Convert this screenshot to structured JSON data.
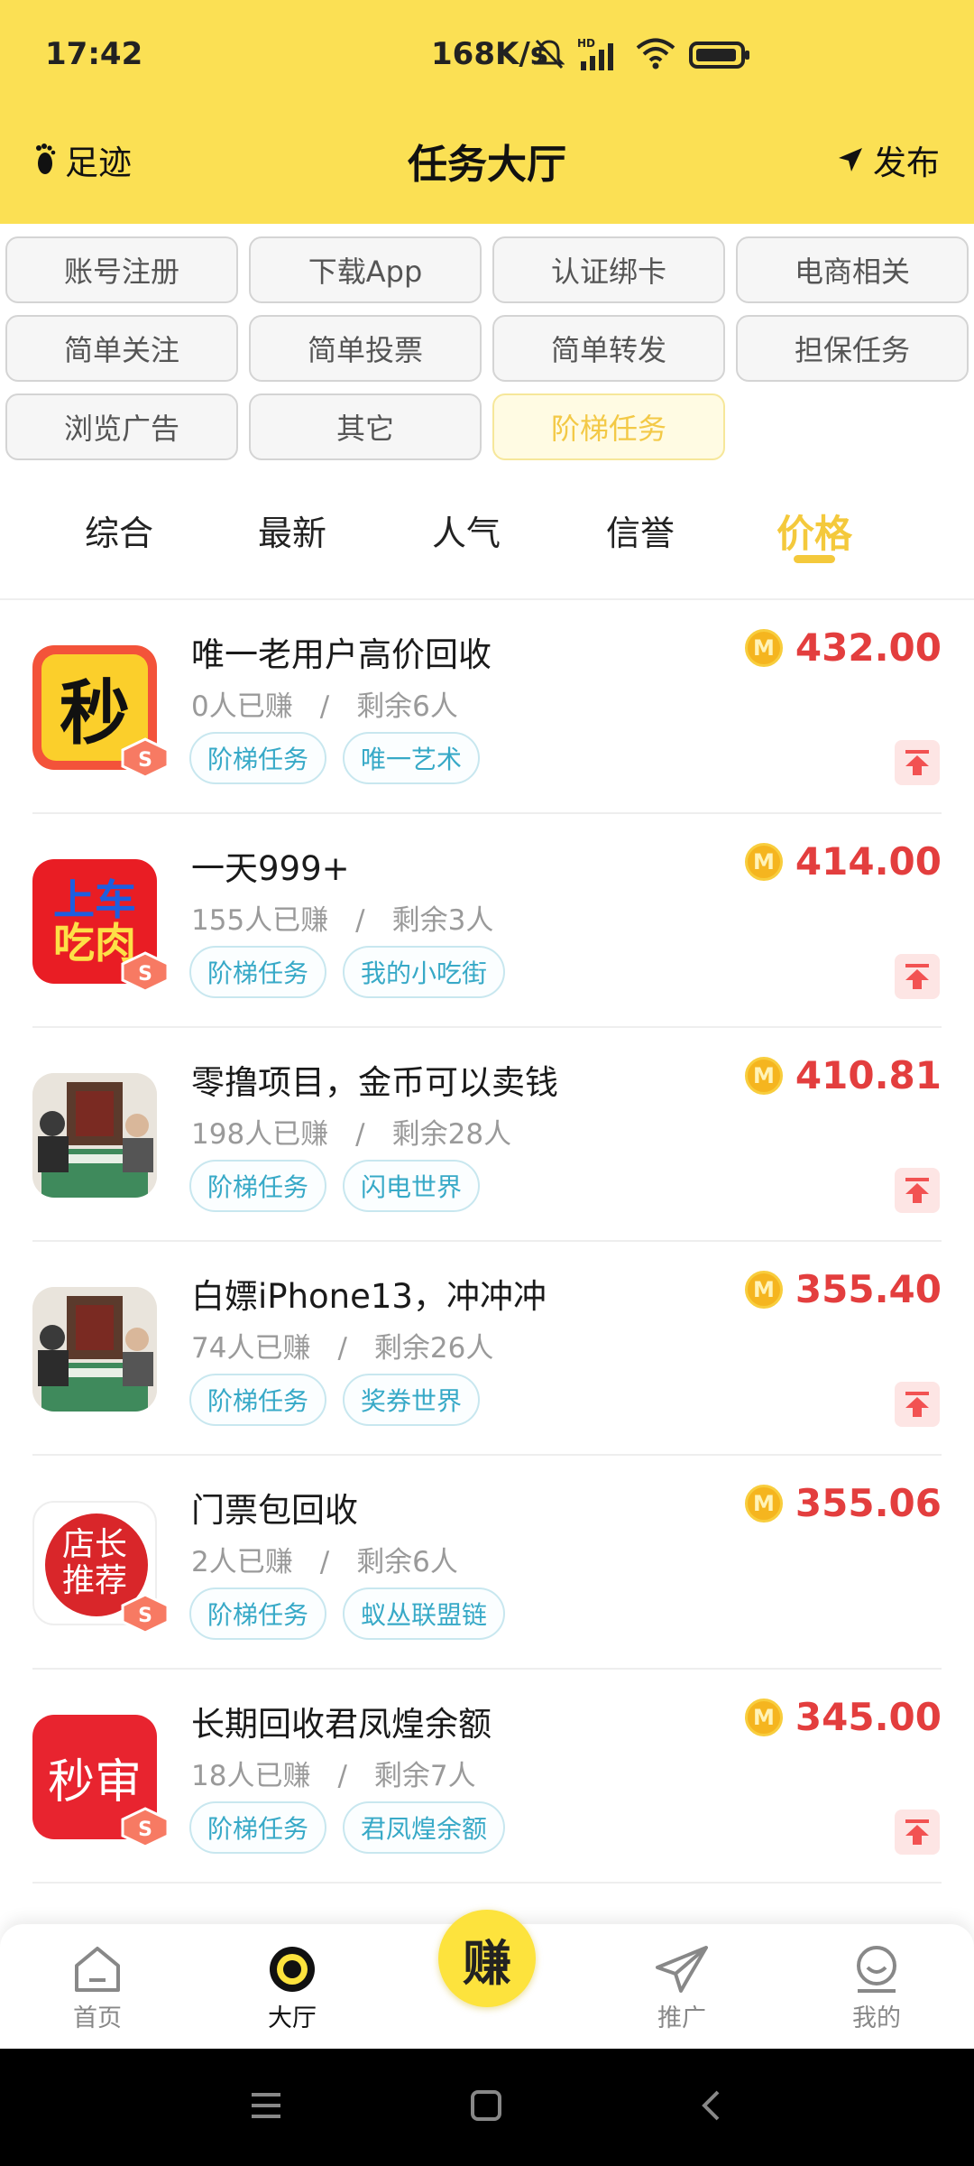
{
  "status": {
    "time": "17:42",
    "speed": "168K/s"
  },
  "nav": {
    "left_label": "足迹",
    "title": "任务大厅",
    "right_label": "发布"
  },
  "categories": [
    {
      "label": "账号注册",
      "active": false
    },
    {
      "label": "下载App",
      "active": false
    },
    {
      "label": "认证绑卡",
      "active": false
    },
    {
      "label": "电商相关",
      "active": false
    },
    {
      "label": "简单关注",
      "active": false
    },
    {
      "label": "简单投票",
      "active": false
    },
    {
      "label": "简单转发",
      "active": false
    },
    {
      "label": "担保任务",
      "active": false
    },
    {
      "label": "浏览广告",
      "active": false
    },
    {
      "label": "其它",
      "active": false
    },
    {
      "label": "阶梯任务",
      "active": true
    }
  ],
  "sort_tabs": [
    {
      "label": "综合",
      "active": false
    },
    {
      "label": "最新",
      "active": false
    },
    {
      "label": "人气",
      "active": false
    },
    {
      "label": "信誉",
      "active": false
    },
    {
      "label": "价格",
      "active": true
    }
  ],
  "tasks": [
    {
      "title": "唯一老用户高价回收",
      "earned": "0人已赚",
      "remaining": "剩余6人",
      "tags": [
        "阶梯任务",
        "唯一艺术"
      ],
      "price": "432.00",
      "icon": "miao-icon",
      "icon_text": "秒",
      "has_top": true
    },
    {
      "title": "一天999+",
      "earned": "155人已赚",
      "remaining": "剩余3人",
      "tags": [
        "阶梯任务",
        "我的小吃街"
      ],
      "price": "414.00",
      "icon": "shangche-chirou-icon",
      "icon_text_1": "上车",
      "icon_text_2": "吃肉",
      "has_top": true
    },
    {
      "title": "零撸项目，金币可以卖钱",
      "earned": "198人已赚",
      "remaining": "剩余28人",
      "tags": [
        "阶梯任务",
        "闪电世界"
      ],
      "price": "410.81",
      "icon": "photo-avatar-icon",
      "has_top": true
    },
    {
      "title": "白嫖iPhone13，冲冲冲",
      "earned": "74人已赚",
      "remaining": "剩余26人",
      "tags": [
        "阶梯任务",
        "奖券世界"
      ],
      "price": "355.40",
      "icon": "photo-avatar-icon",
      "has_top": true
    },
    {
      "title": "门票包回收",
      "earned": "2人已赚",
      "remaining": "剩余6人",
      "tags": [
        "阶梯任务",
        "蚁丛联盟链"
      ],
      "price": "355.06",
      "icon": "dianzhang-tuijian-icon",
      "icon_text_1": "店长",
      "icon_text_2": "推荐",
      "has_top": false
    },
    {
      "title": "长期回收君凤煌余额",
      "earned": "18人已赚",
      "remaining": "剩余7人",
      "tags": [
        "阶梯任务",
        "君凤煌余额"
      ],
      "price": "345.00",
      "icon": "miaoshen-icon",
      "icon_text": "秒审",
      "has_top": true
    }
  ],
  "coin_symbol": "M",
  "bottom_nav": {
    "home": "首页",
    "hall": "大厅",
    "earn": "赚",
    "promote": "推广",
    "mine": "我的"
  },
  "colors": {
    "brand_yellow": "#fbe054",
    "accent_gold": "#f4c93c",
    "price_red": "#e33e3e",
    "tag_blue": "#37a9c7"
  }
}
